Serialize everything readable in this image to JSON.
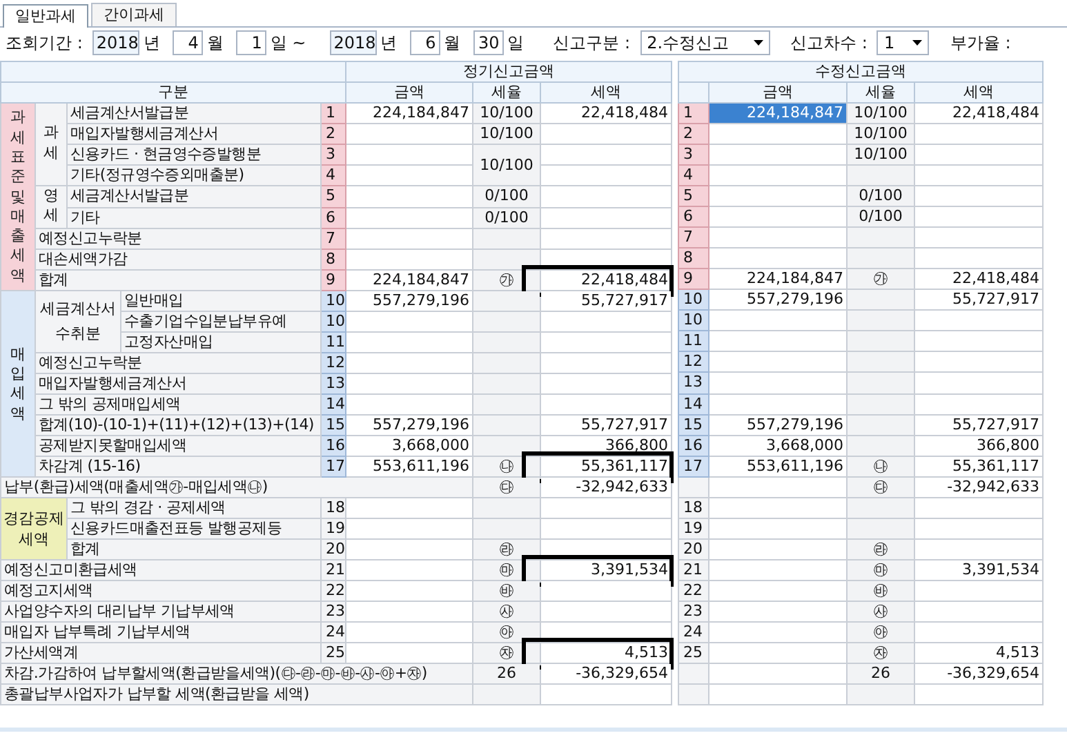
{
  "tabs": [
    {
      "label": "일반과세",
      "selected": true
    },
    {
      "label": "간이과세",
      "selected": false
    }
  ],
  "filter": {
    "period_label": "조회기간 :",
    "start_year": "2018",
    "year_unit": "년",
    "start_month": "4",
    "month_unit": "월",
    "start_day": "1",
    "day_unit": "일 ~",
    "end_year": "2018",
    "end_year_unit": "년",
    "end_month": "6",
    "end_month_unit": "월",
    "end_day": "30",
    "end_day_unit": "일",
    "report_type_label": "신고구분 :",
    "report_type": "2.수정신고",
    "report_seq_label": "신고차수 :",
    "report_seq": "1",
    "vat_rate_label": "부가율 :"
  },
  "header": {
    "section": "구분",
    "regular": "정기신고금액",
    "revised": "수정신고금액",
    "columns": [
      "금액",
      "세율",
      "세액"
    ],
    "revised_columns": [
      "금액",
      "세율",
      "세액"
    ]
  },
  "sections": [
    {
      "kind": "sales",
      "label": "과세표준및매출세액",
      "blocks": [
        {
          "label": "과세",
          "rows": [
            {
              "label": "세금계산서발급분",
              "no": "1",
              "amount": "224,184,847",
              "rate": "10/100",
              "tax": "22,418,484",
              "annotated": false,
              "revised": {
                "no": "1",
                "amount": "224,184,847",
                "rate": "10/100",
                "tax": "22,418,484",
                "selected": true
              }
            },
            {
              "label": "매입자발행세금계산서",
              "no": "2",
              "rate": "10/100",
              "annotated": false,
              "revised": {
                "no": "2",
                "rate": "10/100",
                "selected": false
              }
            },
            {
              "label": "신용카드 · 현금영수증발행분",
              "no": "3",
              "rate": "10/100",
              "annotated": false,
              "revised": {
                "no": "3",
                "rate": "10/100",
                "selected": false
              }
            },
            {
              "label": "기타(정규영수증외매출분)",
              "no": "4",
              "annotated": false,
              "revised": {
                "no": "4",
                "selected": false
              }
            }
          ]
        },
        {
          "label": "영세",
          "rows": [
            {
              "label": "세금계산서발급분",
              "no": "5",
              "rate": "0/100",
              "annotated": false,
              "revised": {
                "no": "5",
                "rate": "0/100",
                "selected": false
              }
            },
            {
              "label": "기타",
              "no": "6",
              "rate": "0/100",
              "annotated": false,
              "revised": {
                "no": "6",
                "rate": "0/100",
                "selected": false
              }
            }
          ]
        },
        {
          "rows": [
            {
              "label": "예정신고누락분",
              "no": "7",
              "annotated": false,
              "revised": {
                "no": "7",
                "selected": false
              }
            },
            {
              "label": "대손세액가감",
              "no": "8",
              "annotated": false,
              "revised": {
                "no": "8",
                "selected": false
              }
            },
            {
              "label": "합계",
              "no": "9",
              "amount": "224,184,847",
              "rate": "㉮",
              "tax": "22,418,484",
              "annotated": true,
              "revised": {
                "no": "9",
                "amount": "224,184,847",
                "rate": "㉮",
                "tax": "22,418,484",
                "selected": false
              }
            }
          ]
        }
      ]
    },
    {
      "kind": "purchase",
      "label": "매입세액",
      "blocks": [
        {
          "label": "세금계산서 수취분",
          "rows": [
            {
              "label": "일반매입",
              "no": "10",
              "amount": "557,279,196",
              "tax": "55,727,917",
              "annotated": false,
              "revised": {
                "no": "10",
                "amount": "557,279,196",
                "tax": "55,727,917",
                "selected": false
              }
            },
            {
              "label": "수출기업수입분납부유예",
              "no": "10",
              "annotated": false,
              "revised": {
                "no": "10",
                "selected": false
              }
            },
            {
              "label": "고정자산매입",
              "no": "11",
              "annotated": false,
              "revised": {
                "no": "11",
                "selected": false
              }
            }
          ]
        },
        {
          "rows": [
            {
              "label": "예정신고누락분",
              "no": "12",
              "annotated": false,
              "revised": {
                "no": "12",
                "selected": false
              }
            },
            {
              "label": "매입자발행세금계산서",
              "no": "13",
              "annotated": false,
              "revised": {
                "no": "13",
                "selected": false
              }
            },
            {
              "label": "그 밖의 공제매입세액",
              "no": "14",
              "annotated": false,
              "revised": {
                "no": "14",
                "selected": false
              }
            },
            {
              "label": "합계(10)-(10-1)+(11)+(12)+(13)+(14)",
              "no": "15",
              "amount": "557,279,196",
              "tax": "55,727,917",
              "annotated": false,
              "revised": {
                "no": "15",
                "amount": "557,279,196",
                "tax": "55,727,917",
                "selected": false
              }
            },
            {
              "label": "공제받지못할매입세액",
              "no": "16",
              "amount": "3,668,000",
              "tax": "366,800",
              "annotated": false,
              "revised": {
                "no": "16",
                "amount": "3,668,000",
                "tax": "366,800",
                "selected": false
              }
            },
            {
              "label": "차감계 (15-16)",
              "no": "17",
              "amount": "553,611,196",
              "rate": "㉯",
              "tax": "55,361,117",
              "annotated": true,
              "revised": {
                "no": "17",
                "amount": "553,611,196",
                "rate": "㉯",
                "tax": "55,361,117",
                "selected": false
              }
            }
          ]
        }
      ]
    },
    {
      "kind": "total",
      "rows": [
        {
          "label": "납부(환급)세액(매출세액㉮-매입세액㉯)",
          "rate": "㉰",
          "tax": "-32,942,633",
          "annotated": false,
          "revised": {
            "rate": "㉰",
            "tax": "-32,942,633",
            "selected": false
          }
        }
      ]
    },
    {
      "kind": "relief",
      "label": "경감공제세액",
      "blocks": [
        {
          "rows": [
            {
              "label": "그 밖의 경감 · 공제세액",
              "no": "18",
              "annotated": false,
              "revised": {
                "no": "18",
                "selected": false
              }
            },
            {
              "label": "신용카드매출전표등 발행공제등",
              "no": "19",
              "annotated": false,
              "revised": {
                "no": "19",
                "selected": false
              }
            },
            {
              "label": "합계",
              "no": "20",
              "rate": "㉱",
              "annotated": false,
              "revised": {
                "no": "20",
                "rate": "㉱",
                "selected": false
              }
            }
          ]
        }
      ]
    },
    {
      "kind": "plain",
      "rows": [
        {
          "label": "예정신고미환급세액",
          "no": "21",
          "rate": "㉲",
          "tax": "3,391,534",
          "annotated": true,
          "revised": {
            "no": "21",
            "rate": "㉲",
            "tax": "3,391,534",
            "selected": false
          }
        },
        {
          "label": "예정고지세액",
          "no": "22",
          "rate": "㉳",
          "annotated": false,
          "revised": {
            "no": "22",
            "rate": "㉳",
            "selected": false
          }
        },
        {
          "label": "사업양수자의 대리납부 기납부세액",
          "no": "23",
          "rate": "㉴",
          "annotated": false,
          "revised": {
            "no": "23",
            "rate": "㉴",
            "selected": false
          }
        },
        {
          "label": "매입자 납부특례 기납부세액",
          "no": "24",
          "rate": "㉵",
          "annotated": false,
          "revised": {
            "no": "24",
            "rate": "㉵",
            "selected": false
          }
        },
        {
          "label": "가산세액계",
          "no": "25",
          "rate": "㉶",
          "tax": "4,513",
          "annotated": true,
          "revised": {
            "no": "25",
            "rate": "㉶",
            "tax": "4,513",
            "selected": false
          }
        }
      ]
    },
    {
      "kind": "total",
      "rows": [
        {
          "label": "차감.가감하여 납부할세액(환급받을세액)(㉰-㉱-㉲-㉳-㉴-㉵+㉶)",
          "rate": "26",
          "tax": "-36,329,654",
          "annotated": false,
          "revised": {
            "rate": "26",
            "tax": "-36,329,654",
            "selected": false
          }
        },
        {
          "label": "총괄납부사업자가 납부할 세액(환급받을 세액)",
          "annotated": false,
          "revised": {
            "selected": false
          }
        }
      ]
    }
  ]
}
